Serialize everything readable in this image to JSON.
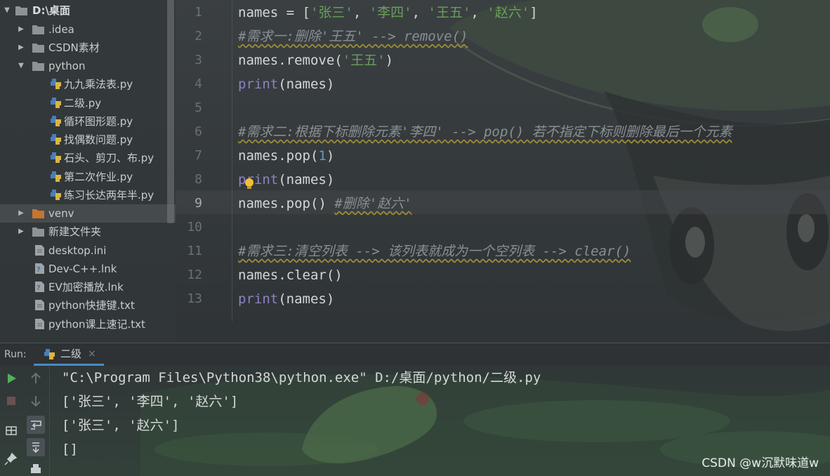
{
  "project_tree": {
    "root": "D:\\桌面",
    "items": [
      {
        "label": ".idea",
        "kind": "folder",
        "expanded": false
      },
      {
        "label": "CSDN素材",
        "kind": "folder",
        "expanded": false
      },
      {
        "label": "python",
        "kind": "folder",
        "expanded": true
      },
      {
        "label": "九九乘法表.py",
        "kind": "python-file"
      },
      {
        "label": "二级.py",
        "kind": "python-file"
      },
      {
        "label": "循环图形题.py",
        "kind": "python-file"
      },
      {
        "label": "找偶数问题.py",
        "kind": "python-file"
      },
      {
        "label": "石头、剪刀、布.py",
        "kind": "python-file"
      },
      {
        "label": "第二次作业.py",
        "kind": "python-file"
      },
      {
        "label": "练习长达两年半.py",
        "kind": "python-file"
      },
      {
        "label": "venv",
        "kind": "folder-orange",
        "expanded": false
      },
      {
        "label": "新建文件夹",
        "kind": "folder",
        "expanded": false
      },
      {
        "label": "desktop.ini",
        "kind": "text-file"
      },
      {
        "label": "Dev-C++.lnk",
        "kind": "link-file"
      },
      {
        "label": "EV加密播放.lnk",
        "kind": "link-file"
      },
      {
        "label": "python快捷键.txt",
        "kind": "text-file"
      },
      {
        "label": "python课上速记.txt",
        "kind": "text-file"
      }
    ]
  },
  "editor": {
    "current_line": 9,
    "line_numbers": [
      "1",
      "2",
      "3",
      "4",
      "5",
      "6",
      "7",
      "8",
      "9",
      "10",
      "11",
      "12",
      "13"
    ],
    "lines": [
      {
        "parts": [
          [
            "names = [",
            "plain"
          ],
          [
            "'张三'",
            "str"
          ],
          [
            ", ",
            "plain"
          ],
          [
            "'李四'",
            "str"
          ],
          [
            ", ",
            "plain"
          ],
          [
            "'王五'",
            "str"
          ],
          [
            ", ",
            "plain"
          ],
          [
            "'赵六'",
            "str"
          ],
          [
            "]",
            "plain"
          ]
        ]
      },
      {
        "parts": [
          [
            "#需求一:删除'王五' --> remove()",
            "cmt"
          ]
        ]
      },
      {
        "parts": [
          [
            "names.remove(",
            "plain"
          ],
          [
            "'王五'",
            "str"
          ],
          [
            ")",
            "plain"
          ]
        ]
      },
      {
        "parts": [
          [
            "print",
            "fn"
          ],
          [
            "(names)",
            "plain"
          ]
        ]
      },
      {
        "parts": []
      },
      {
        "parts": [
          [
            "#需求二:根据下标删除元素'李四' --> pop() 若不指定下标则删除最后一个元素",
            "cmt"
          ]
        ]
      },
      {
        "parts": [
          [
            "names.pop(",
            "plain"
          ],
          [
            "1",
            "num"
          ],
          [
            ")",
            "plain"
          ]
        ]
      },
      {
        "parts": [
          [
            "print",
            "fn"
          ],
          [
            "(names)",
            "plain"
          ]
        ]
      },
      {
        "parts": [
          [
            "names.pop() ",
            "plain"
          ],
          [
            "#删除'赵六'",
            "cmt"
          ]
        ]
      },
      {
        "parts": []
      },
      {
        "parts": [
          [
            "#需求三:清空列表 --> 该列表就成为一个空列表 --> clear()",
            "cmt"
          ]
        ]
      },
      {
        "parts": [
          [
            "names.clear()",
            "plain"
          ]
        ]
      },
      {
        "parts": [
          [
            "print",
            "fn"
          ],
          [
            "(names)",
            "plain"
          ]
        ]
      }
    ]
  },
  "run_panel": {
    "label": "Run:",
    "tab_label": "二级",
    "tab_close": "×",
    "output": [
      "\"C:\\Program Files\\Python38\\python.exe\" D:/桌面/python/二级.py",
      "['张三', '李四', '赵六']",
      "['张三', '赵六']",
      "[]"
    ]
  },
  "watermark": "CSDN @w沉默味道w",
  "colors": {
    "string": "#6a9f59",
    "function": "#8d82c2",
    "number": "#6897bb",
    "comment": "#8a8f94",
    "accent": "#4a88c7"
  }
}
